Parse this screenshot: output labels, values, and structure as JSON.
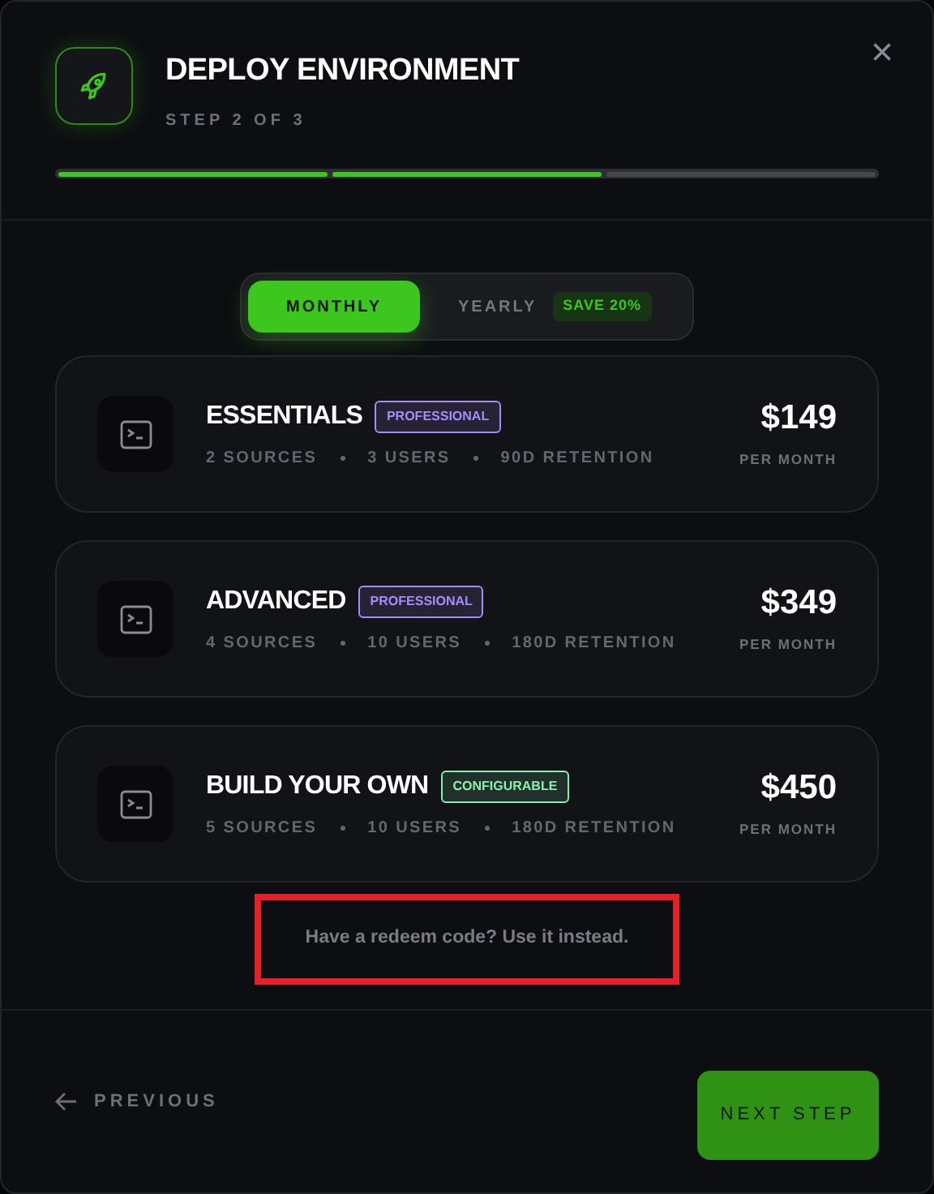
{
  "dialog": {
    "title": "DEPLOY ENVIRONMENT",
    "subtitle": "STEP 2 OF 3",
    "close": "×"
  },
  "progress": [
    {
      "complete": true
    },
    {
      "complete": true
    },
    {
      "complete": false
    }
  ],
  "billing_toggle": [
    {
      "label": "MONTHLY",
      "selected": true
    },
    {
      "label": "YEARLY",
      "selected": false,
      "badge": "SAVE 20%"
    }
  ],
  "plans": [
    {
      "name": "ESSENTIALS",
      "tag": {
        "label": "PROFESSIONAL",
        "color": "#a78bfa"
      },
      "features": [
        "2 SOURCES",
        "3 USERS",
        "90D RETENTION"
      ],
      "price": "$149",
      "period": "PER MONTH"
    },
    {
      "name": "ADVANCED",
      "tag": {
        "label": "PROFESSIONAL",
        "color": "#a78bfa"
      },
      "features": [
        "4 SOURCES",
        "10 USERS",
        "180D RETENTION"
      ],
      "price": "$349",
      "period": "PER MONTH"
    },
    {
      "name": "BUILD YOUR OWN",
      "tag": {
        "label": "CONFIGURABLE",
        "color": "#86efac"
      },
      "features": [
        "5 SOURCES",
        "10 USERS",
        "180D RETENTION"
      ],
      "price": "$450",
      "period": "PER MONTH"
    }
  ],
  "redeem_link": {
    "text": "Have a redeem code? Use it instead.",
    "highlighted": true
  },
  "footer": {
    "previous": "PREVIOUS",
    "next": "NEXT STEP"
  }
}
